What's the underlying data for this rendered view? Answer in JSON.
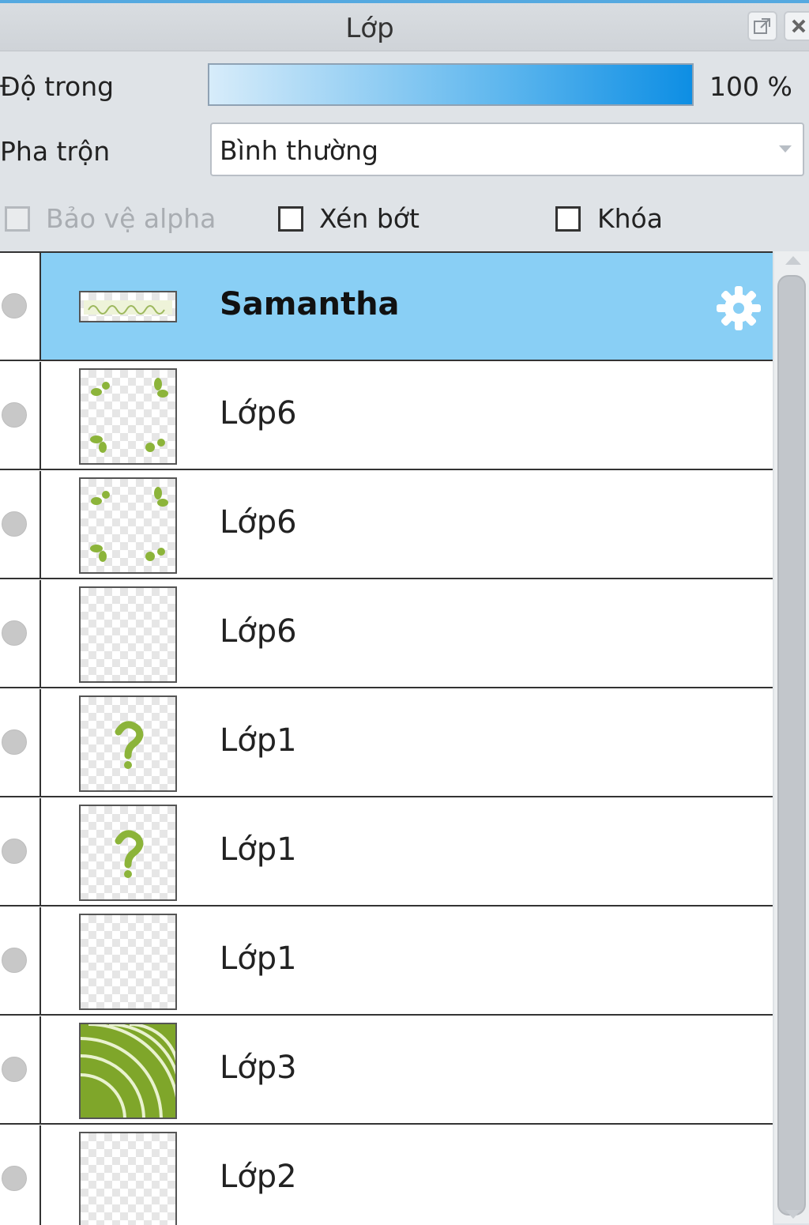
{
  "panel": {
    "title": "Lớp",
    "accent_color": "#55a9e0"
  },
  "opacity": {
    "label": "Độ trong",
    "value_text": "100 %",
    "value": 100
  },
  "blend": {
    "label": "Pha trộn",
    "selected": "Bình thường"
  },
  "options": {
    "protect_alpha": {
      "label": "Bảo vệ alpha",
      "checked": false,
      "disabled": true
    },
    "clipping": {
      "label": "Xén bớt",
      "checked": false
    },
    "lock": {
      "label": "Khóa",
      "checked": false
    }
  },
  "layers": [
    {
      "name": "Samantha",
      "selected": true,
      "thumb": "text-banner",
      "has_settings_icon": true
    },
    {
      "name": "Lớp6",
      "thumb": "leaf-corners"
    },
    {
      "name": "Lớp6",
      "thumb": "leaf-corners"
    },
    {
      "name": "Lớp6",
      "thumb": "blank"
    },
    {
      "name": "Lớp1",
      "thumb": "question-mark"
    },
    {
      "name": "Lớp1",
      "thumb": "question-mark"
    },
    {
      "name": "Lớp1",
      "thumb": "blank"
    },
    {
      "name": "Lớp3",
      "thumb": "green-arcs"
    },
    {
      "name": "Lớp2",
      "thumb": "blank"
    }
  ],
  "icons": {
    "popout": "popout-icon",
    "close": "close-icon",
    "settings": "gear-icon",
    "visibility": "visibility-dot-icon"
  }
}
